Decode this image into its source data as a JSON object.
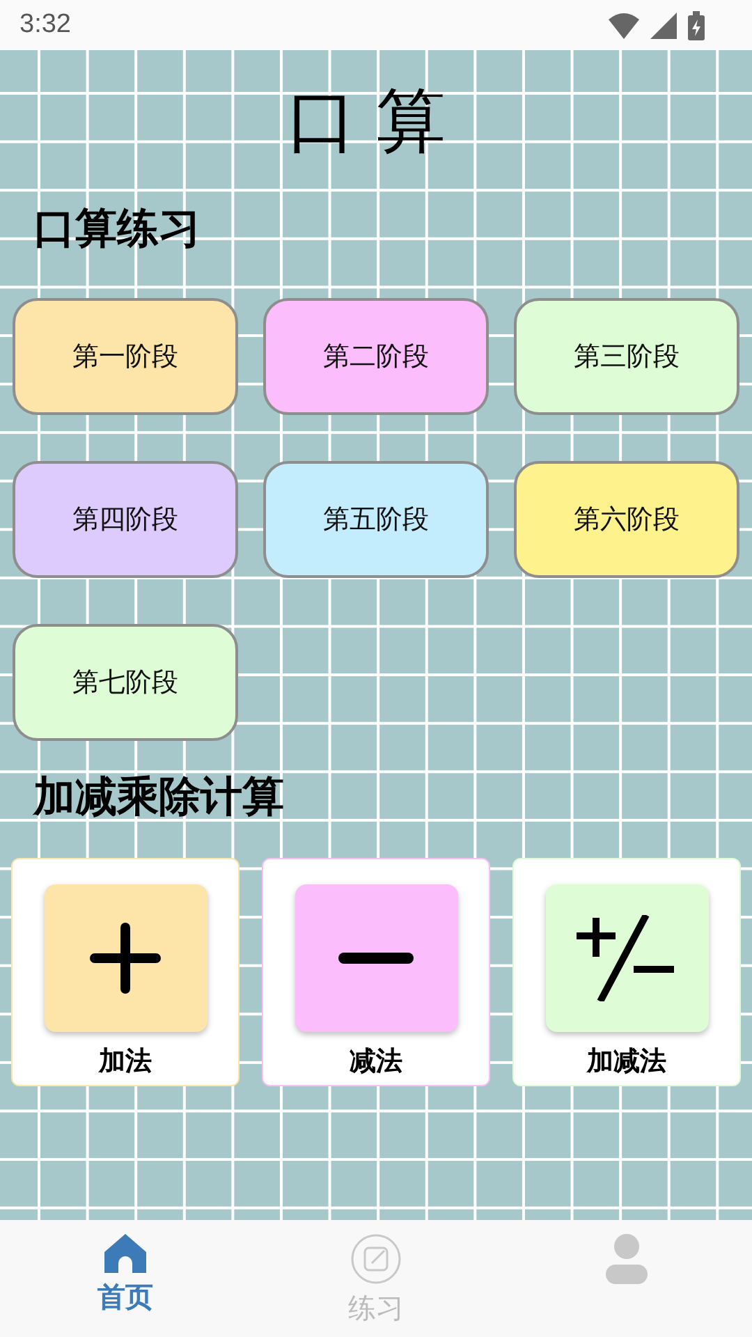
{
  "status_bar": {
    "time": "3:32"
  },
  "title": "口算",
  "sections": [
    {
      "heading": "口算练习",
      "kind": "stages",
      "items": [
        {
          "label": "第一阶段",
          "color": "#fde4a8"
        },
        {
          "label": "第二阶段",
          "color": "#fbbdfb"
        },
        {
          "label": "第三阶段",
          "color": "#defcd6"
        },
        {
          "label": "第四阶段",
          "color": "#dccbfc"
        },
        {
          "label": "第五阶段",
          "color": "#c3ecfd"
        },
        {
          "label": "第六阶段",
          "color": "#fef28c"
        },
        {
          "label": "第七阶段",
          "color": "#defcd6"
        }
      ]
    },
    {
      "heading": "加减乘除计算",
      "kind": "operations",
      "items": [
        {
          "label": "加法",
          "color": "#fde4a8",
          "kind": "plus"
        },
        {
          "label": "减法",
          "color": "#fbbdfb",
          "kind": "minus"
        },
        {
          "label": "加减法",
          "color": "#defcd6",
          "kind": "plus-minus"
        }
      ]
    }
  ],
  "tabs": [
    {
      "label": "首页",
      "kind": "home",
      "selected": true
    },
    {
      "label": "练习",
      "kind": "practice",
      "selected": false
    },
    {
      "kind": "profile",
      "selected": false
    }
  ]
}
